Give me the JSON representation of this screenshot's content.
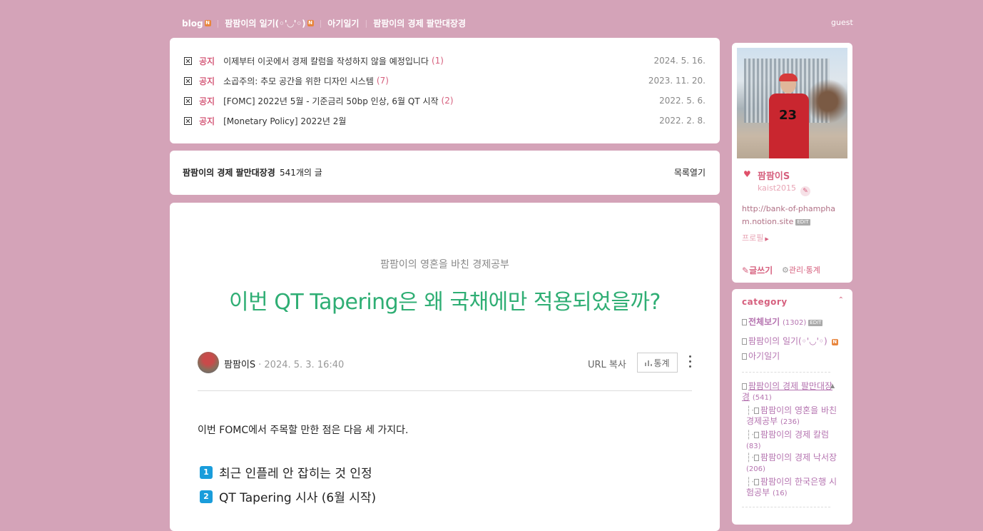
{
  "topnav": {
    "items": [
      "blog",
      "팜팜이의 일기(◦'◡'◦)",
      "아기일기",
      "팜팜이의 경제 팔만대장경"
    ],
    "badge": "N",
    "guest": "guest"
  },
  "notices": [
    {
      "tag": "공지",
      "title": "이제부터 이곳에서 경제 칼럼을 작성하지 않을 예정입니다",
      "count": "(1)",
      "date": "2024. 5. 16."
    },
    {
      "tag": "공지",
      "title": "소곱주의: 추모 공간을 위한 디자인 시스템",
      "count": "(7)",
      "date": "2023. 11. 20."
    },
    {
      "tag": "공지",
      "title": "[FOMC] 2022년 5월 - 기준금리 50bp 인상, 6월 QT 시작",
      "count": "(2)",
      "date": "2022. 5. 6."
    },
    {
      "tag": "공지",
      "title": "[Monetary Policy] 2022년 2월",
      "count": "",
      "date": "2022. 2. 8."
    }
  ],
  "category_header": {
    "name": "팜팜이의 경제 팔만대장경",
    "count": "541개의 글",
    "open_list": "목록열기"
  },
  "article": {
    "category": "팜팜이의 영혼을 바친 경제공부",
    "title": "이번 QT Tapering은 왜 국채에만 적용되었을까?",
    "author": "팜팜이S",
    "date": "· 2024. 5. 3. 16:40",
    "url_copy": "URL 복사",
    "stats": "통계",
    "paragraph": "이번 FOMC에서 주목할 만한 점은 다음 세 가지다.",
    "list": [
      {
        "num": "1",
        "text": "최근 인플레 안 잡히는 것 인정"
      },
      {
        "num": "2",
        "text": "QT Tapering 시사 (6월 시작)"
      }
    ]
  },
  "profile": {
    "name": "팜팜이S",
    "id": "kaist2015",
    "url": "http://bank-of-phampham.notion.site",
    "edit": "EDIT",
    "profile_link": "프로필",
    "write": "글쓰기",
    "admin": "관리·통계"
  },
  "category": {
    "title": "category",
    "all": {
      "label": "전체보기",
      "count": "(1302)",
      "edit": "EDIT"
    },
    "items": [
      {
        "label": "팜팜이의 일기(◦'◡'◦)",
        "badge": "N"
      },
      {
        "label": "아기일기"
      }
    ],
    "economy": {
      "label": "팜팜이의 경제 팔만대장경",
      "count": "(541)"
    },
    "subs": [
      {
        "label": "팜팜이의 영혼을 바친 경제공부",
        "count": "(236)"
      },
      {
        "label": "팜팜이의 경제 칼럼",
        "count": "(83)"
      },
      {
        "label": "팜팜이의 경제 낙서장",
        "count": "(206)"
      },
      {
        "label": "팜팜이의 한국은행 시험공부",
        "count": "(16)"
      }
    ]
  }
}
